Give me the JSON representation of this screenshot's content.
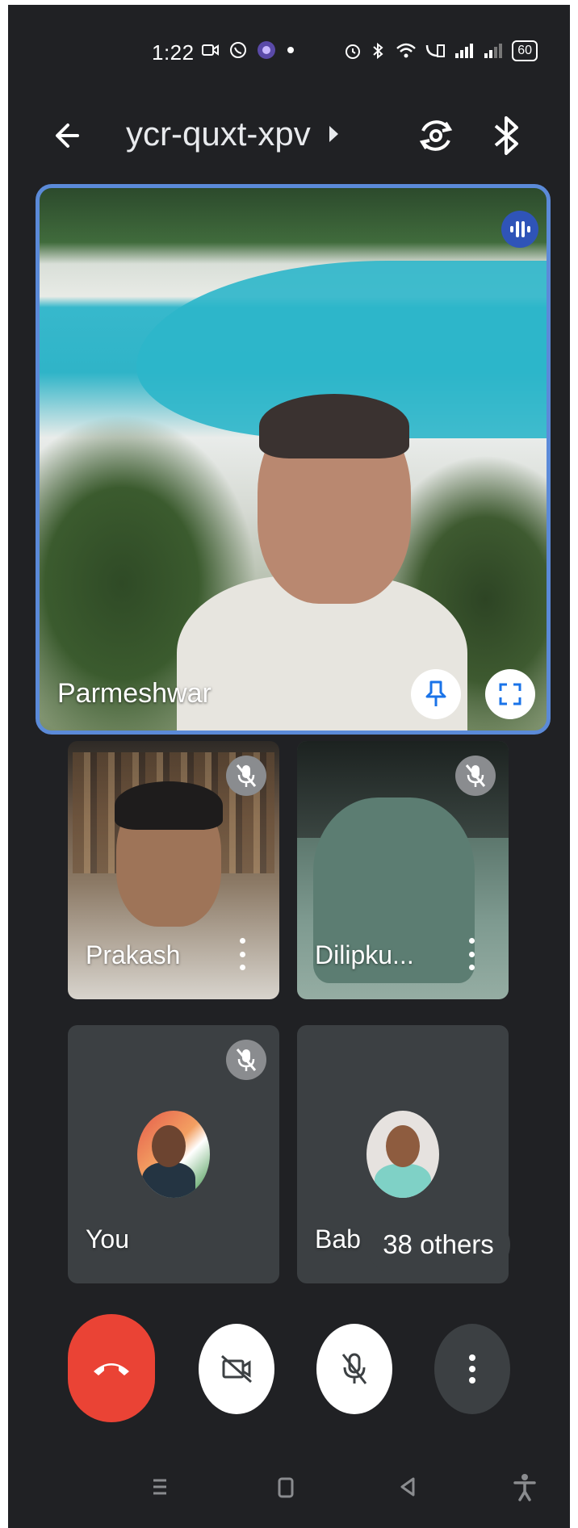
{
  "status_bar": {
    "time": "1:22",
    "battery": "60"
  },
  "header": {
    "meeting_code": "ycr-quxt-xpv"
  },
  "main_tile": {
    "participant": "Parmeshwar"
  },
  "tiles": [
    {
      "name": "Prakash"
    },
    {
      "name": "Dilipku..."
    },
    {
      "name": "You"
    },
    {
      "name": "Bab"
    }
  ],
  "others_label": "38 others",
  "colors": {
    "background": "#202124",
    "active_speaker_border": "#5b8ad8",
    "hangup": "#ea4335"
  },
  "icons": {
    "back": "arrow-left-icon",
    "flip_camera": "flip-camera-icon",
    "bluetooth": "bluetooth-icon",
    "speaking": "audio-wave-icon",
    "pin": "pin-icon",
    "fullscreen": "fullscreen-icon",
    "muted": "mic-off-icon",
    "more": "more-vert-icon",
    "hang_up": "call-end-icon",
    "camera_off": "videocam-off-icon",
    "mic_off": "mic-off-icon"
  }
}
